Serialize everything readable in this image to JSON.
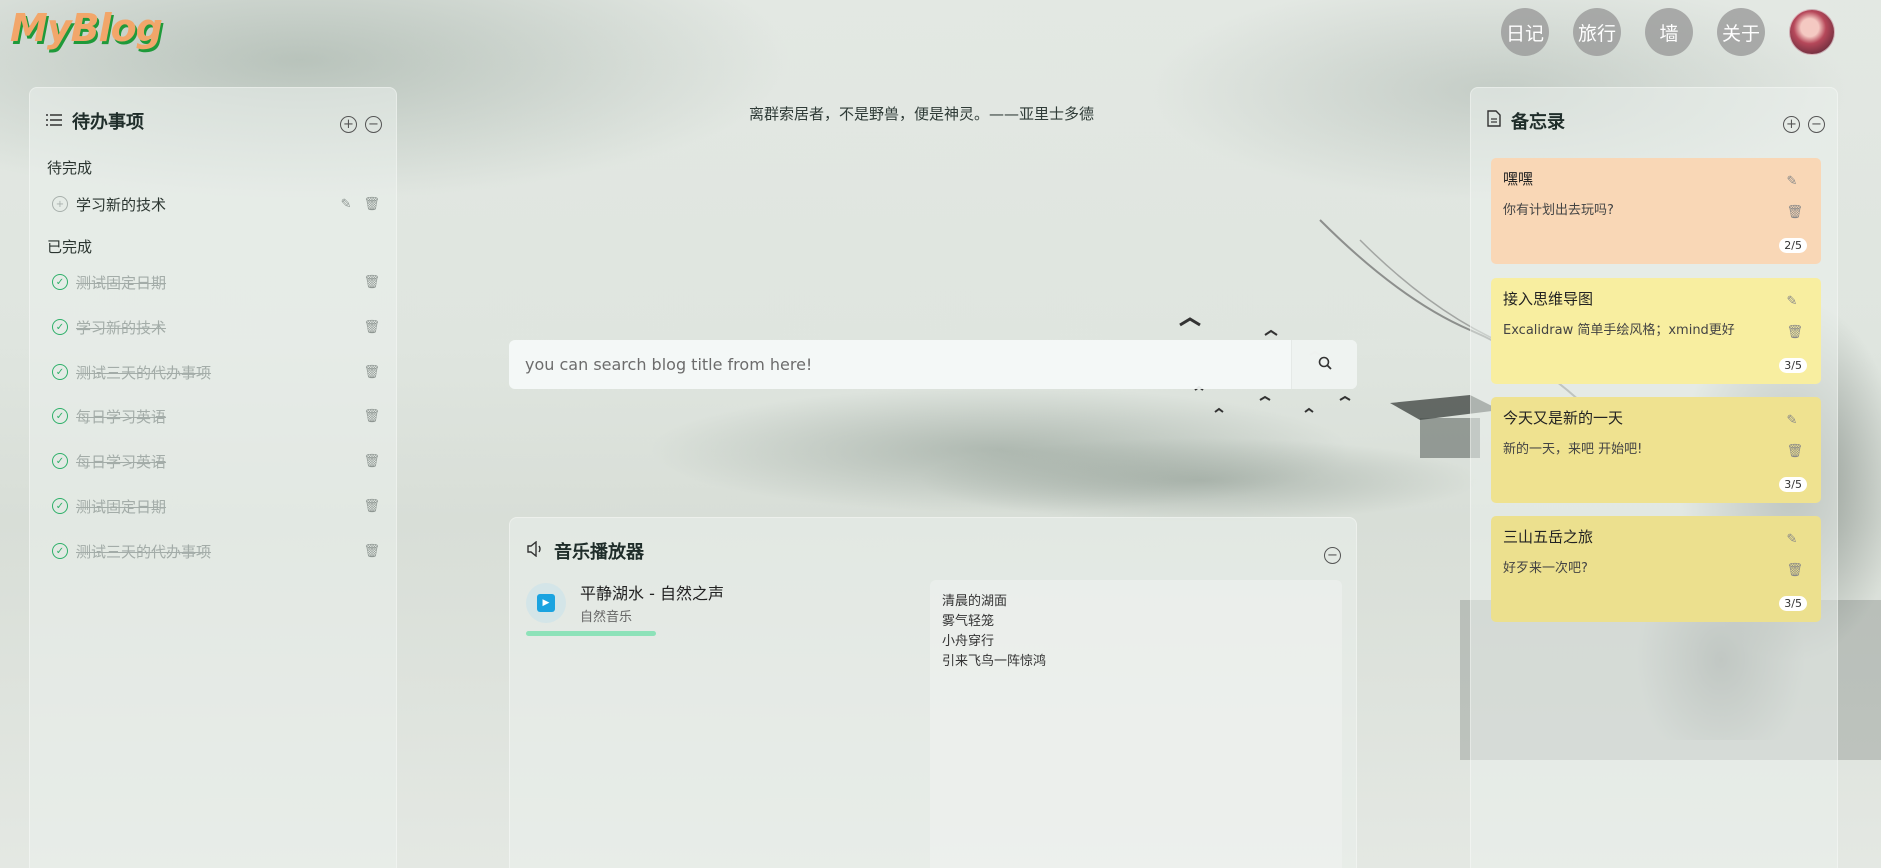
{
  "header": {
    "logo": "MyBlog",
    "nav": [
      "日记",
      "旅行",
      "墙",
      "关于"
    ]
  },
  "todo": {
    "title": "待办事项",
    "pending_label": "待完成",
    "pending": [
      "学习新的技术"
    ],
    "done_label": "已完成",
    "done": [
      "测试固定日期",
      "学习新的技术",
      "测试三天的代办事项",
      "每日学习英语",
      "每日学习英语",
      "测试固定日期",
      "测试三天的代办事项"
    ]
  },
  "quote": "离群索居者，不是野兽，便是神灵。——亚里士多德",
  "search": {
    "placeholder": "you can search blog title from here!"
  },
  "music": {
    "title": "音乐播放器",
    "track_name": "平静湖水 - 自然之声",
    "artist": "自然音乐",
    "progress": 0.33,
    "lyrics": [
      "清晨的湖面",
      "雾气轻笼",
      "小舟穿行",
      "引来飞鸟一阵惊鸿"
    ]
  },
  "memo": {
    "title": "备忘录",
    "cards": [
      {
        "title": "嘿嘿",
        "body": "你有计划出去玩吗?",
        "count": "2/5",
        "color": "#f9d7b6"
      },
      {
        "title": "接入思维导图",
        "body": "Excalidraw 简单手绘风格；xmind更好",
        "count": "3/5",
        "color": "#f8eea0"
      },
      {
        "title": "今天又是新的一天",
        "body": "新的一天，来吧 开始吧!",
        "count": "3/5",
        "color": "#efe290"
      },
      {
        "title": "三山五岳之旅",
        "body": "好歹来一次吧?",
        "count": "3/5",
        "color": "#ece08e"
      }
    ]
  }
}
